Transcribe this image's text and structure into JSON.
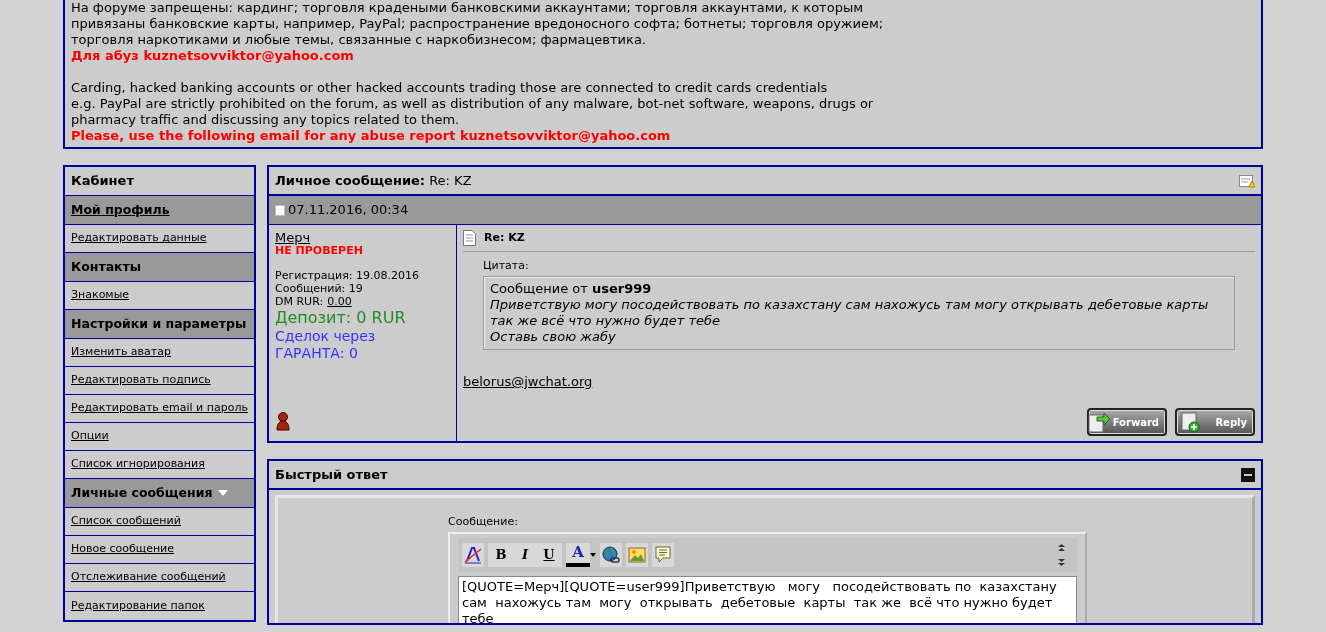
{
  "notice": {
    "blocks": [
      {
        "lines": [
          "На форуме запрещены: кардинг; торговля крадеными банковскими аккаунтами; торговля аккаунтами, к которым",
          "привязаны банковские карты, например, PayPal; распространение вредоносного софта; ботнеты; торговля оружием;",
          "торговля наркотиками и любые темы, связанные с наркобизнесом; фармацевтика."
        ],
        "alert": "Для абуз kuznetsovviktor@yahoo.com"
      },
      {
        "lines": [
          "Carding, hacked banking accounts or other hacked accounts trading those are connected to credit cards credentials",
          "e.g. PayPal are strictly prohibited on the forum, as well as distribution of any malware, bot-net software, weapons, drugs or",
          "pharmacy traffic and discussing any topics related to them."
        ],
        "alert": "Please, use the following email for any abuse report kuznetsovviktor@yahoo.com"
      }
    ]
  },
  "sidebar": {
    "items": [
      {
        "kind": "title",
        "label": "Кабинет",
        "dropdown": false
      },
      {
        "kind": "header_link",
        "label": "Мой профиль",
        "dropdown": false
      },
      {
        "kind": "link",
        "label": "Редактировать данные",
        "dropdown": false
      },
      {
        "kind": "header",
        "label": "Контакты",
        "dropdown": false
      },
      {
        "kind": "link",
        "label": "Знакомые",
        "dropdown": false
      },
      {
        "kind": "header",
        "label": "Настройки и параметры",
        "dropdown": false
      },
      {
        "kind": "link",
        "label": "Изменить аватар",
        "dropdown": false
      },
      {
        "kind": "link",
        "label": "Редактировать подпись",
        "dropdown": false
      },
      {
        "kind": "link",
        "label": "Редактировать email и пароль",
        "dropdown": false
      },
      {
        "kind": "link",
        "label": "Опции",
        "dropdown": false
      },
      {
        "kind": "link",
        "label": "Список игнорирования",
        "dropdown": false
      },
      {
        "kind": "header",
        "label": "Личные сообщения",
        "dropdown": true
      },
      {
        "kind": "link",
        "label": "Список сообщений",
        "dropdown": false
      },
      {
        "kind": "link",
        "label": "Новое сообщение",
        "dropdown": false
      },
      {
        "kind": "link",
        "label": "Отслеживание сообщений",
        "dropdown": false
      },
      {
        "kind": "link",
        "label": "Редактирование папок",
        "dropdown": false
      }
    ]
  },
  "message": {
    "label": "Личное сообщение:",
    "title": "Re: KZ",
    "date": "07.11.2016, 00:34",
    "user": {
      "name": "Мерч",
      "status": "НЕ ПРОВЕРЕН",
      "registration": "Регистрация: 19.08.2016",
      "posts": "Сообщений: 19",
      "dm_label": "DM RUR:",
      "dm_value": "0.00",
      "deposit": "Депозит: 0 RUR",
      "deals": "Сделок через ГАРАНТА: 0"
    },
    "subject": "Re: KZ",
    "quote_label": "Цитата:",
    "quote_from": "Сообщение от **user999**",
    "quote_lines": [
      "Приветствую могу посодействовать по казахстану сам нахожусь там могу открывать дебетовые карты",
      "так же всё что нужно будет тебе",
      "Оставь свою жабу"
    ],
    "signature": "belorus@jwchat.org",
    "buttons": [
      "Forward",
      "Reply"
    ]
  },
  "quick_reply": {
    "title": "Быстрый ответ",
    "field_label": "Сообщение:",
    "format_letters": [
      "B",
      "I",
      "U"
    ],
    "color_letter": "A",
    "text": "[QUOTE=Мерч][QUOTE=user999]Приветствую   могу   посодействовать по  казахстану сам  нахожусь там  могу  открывать  дебетовые  карты  так же  всё что нужно будет тебе"
  }
}
